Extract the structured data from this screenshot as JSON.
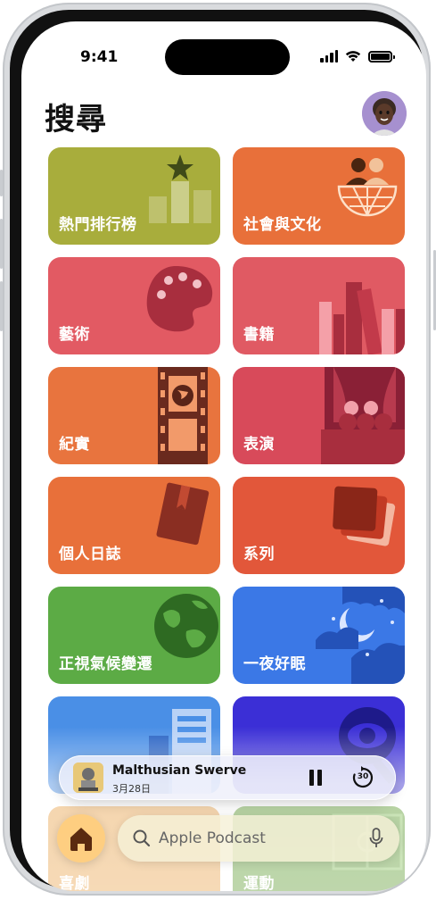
{
  "status": {
    "time": "9:41"
  },
  "page": {
    "title": "搜尋"
  },
  "categories": [
    {
      "label": "熱門排行榜",
      "color": "#a8ad3c"
    },
    {
      "label": "社會與文化",
      "color": "#e8703a"
    },
    {
      "label": "藝術",
      "color": "#e25a63"
    },
    {
      "label": "書籍",
      "color": "#e05a63"
    },
    {
      "label": "紀實",
      "color": "#e8743e"
    },
    {
      "label": "表演",
      "color": "#d84a5a"
    },
    {
      "label": "個人日誌",
      "color": "#e8703a"
    },
    {
      "label": "系列",
      "color": "#e2573a"
    },
    {
      "label": "正視氣候變遷",
      "color": "#5cab45"
    },
    {
      "label": "一夜好眠",
      "color": "#3b78e6"
    },
    {
      "label": "",
      "color": "#4a8fe6"
    },
    {
      "label": "",
      "color": "#3b2fd6"
    },
    {
      "label": "喜劇",
      "color": "#e8a24a"
    },
    {
      "label": "運動",
      "color": "#5c9a2e"
    }
  ],
  "player": {
    "title": "Malthusian Swerve",
    "subtitle": "3月28日",
    "skip_seconds": "30"
  },
  "search": {
    "placeholder": "Apple Podcast"
  },
  "icons": {
    "home": "house-icon",
    "search": "magnifying-glass-icon",
    "mic": "microphone-icon",
    "pause": "pause-icon",
    "skip": "skip-forward-30-icon"
  }
}
